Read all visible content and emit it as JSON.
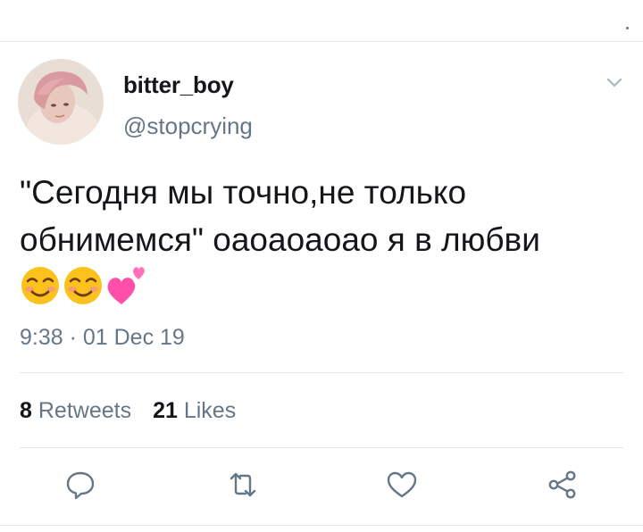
{
  "author": {
    "display_name": "bitter_boy",
    "handle": "@stopcrying",
    "avatar_icon": "profile-photo"
  },
  "tweet": {
    "line1": "\"Сегодня мы точно,не только",
    "line2": "обнимемся\" оаоаоаоао я в любви",
    "emojis": [
      "smiling-face-with-smiling-eyes",
      "smiling-face-with-smiling-eyes",
      "two-hearts"
    ],
    "timestamp": "9:38 · 01 Dec 19"
  },
  "stats": {
    "retweets_count": "8",
    "retweets_label": "Retweets",
    "likes_count": "21",
    "likes_label": "Likes"
  },
  "actions": [
    "reply-icon",
    "retweet-icon",
    "like-icon",
    "share-icon"
  ],
  "colors": {
    "text": "#14171a",
    "secondary": "#657786",
    "divider": "#e1e8ed"
  }
}
